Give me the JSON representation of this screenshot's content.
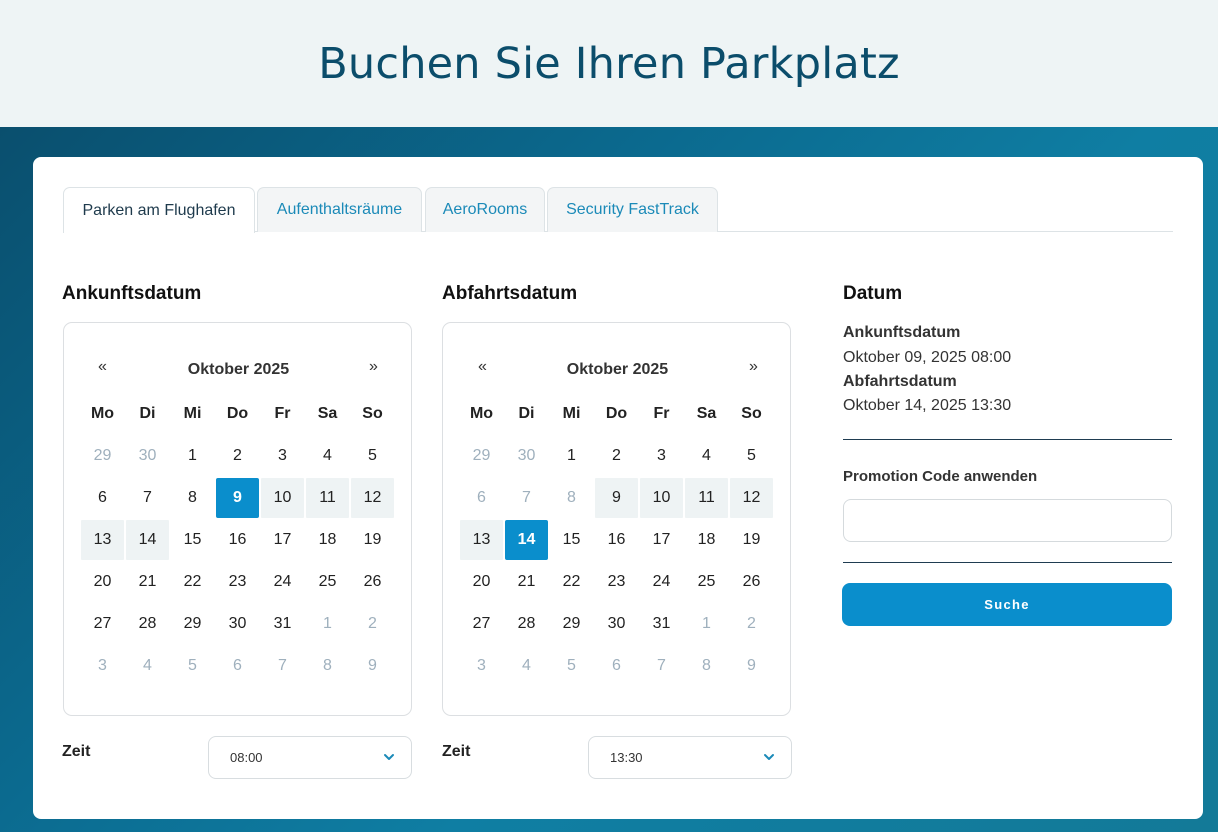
{
  "header": {
    "title": "Buchen Sie Ihren Parkplatz"
  },
  "tabs": [
    {
      "label": "Parken am Flughafen",
      "active": true
    },
    {
      "label": "Aufenthaltsräume"
    },
    {
      "label": "AeroRooms"
    },
    {
      "label": "Security FastTrack"
    }
  ],
  "arrival": {
    "title": "Ankunftsdatum",
    "prev": "«",
    "next": "»",
    "month": "Oktober 2025",
    "weekdays": [
      "Mo",
      "Di",
      "Mi",
      "Do",
      "Fr",
      "Sa",
      "So"
    ],
    "days": [
      [
        "29",
        "30",
        "1",
        "2",
        "3",
        "4",
        "5"
      ],
      [
        "6",
        "7",
        "8",
        "9",
        "10",
        "11",
        "12"
      ],
      [
        "13",
        "14",
        "15",
        "16",
        "17",
        "18",
        "19"
      ],
      [
        "20",
        "21",
        "22",
        "23",
        "24",
        "25",
        "26"
      ],
      [
        "27",
        "28",
        "29",
        "30",
        "31",
        "1",
        "2"
      ],
      [
        "3",
        "4",
        "5",
        "6",
        "7",
        "8",
        "9"
      ]
    ],
    "time_label": "Zeit",
    "time_value": "08:00"
  },
  "departure": {
    "title": "Abfahrtsdatum",
    "prev": "«",
    "next": "»",
    "month": "Oktober 2025",
    "weekdays": [
      "Mo",
      "Di",
      "Mi",
      "Do",
      "Fr",
      "Sa",
      "So"
    ],
    "days": [
      [
        "29",
        "30",
        "1",
        "2",
        "3",
        "4",
        "5"
      ],
      [
        "6",
        "7",
        "8",
        "9",
        "10",
        "11",
        "12"
      ],
      [
        "13",
        "14",
        "15",
        "16",
        "17",
        "18",
        "19"
      ],
      [
        "20",
        "21",
        "22",
        "23",
        "24",
        "25",
        "26"
      ],
      [
        "27",
        "28",
        "29",
        "30",
        "31",
        "1",
        "2"
      ],
      [
        "3",
        "4",
        "5",
        "6",
        "7",
        "8",
        "9"
      ]
    ],
    "time_label": "Zeit",
    "time_value": "13:30"
  },
  "summary": {
    "title": "Datum",
    "arrival_label": "Ankunftsdatum",
    "arrival_value": "Oktober 09, 2025 08:00",
    "departure_label": "Abfahrtsdatum",
    "departure_value": "Oktober 14, 2025 13:30",
    "promo_label": "Promotion Code anwenden",
    "promo_value": "",
    "search_label": "Suche"
  },
  "colors": {
    "accent": "#0a8ecc",
    "title": "#0b4d6b",
    "range_bg": "#eef3f4",
    "muted_day": "#9fb0bd"
  },
  "icons": {
    "prev": "chevron-double-left-icon",
    "next": "chevron-double-right-icon",
    "select": "chevron-down-icon"
  }
}
